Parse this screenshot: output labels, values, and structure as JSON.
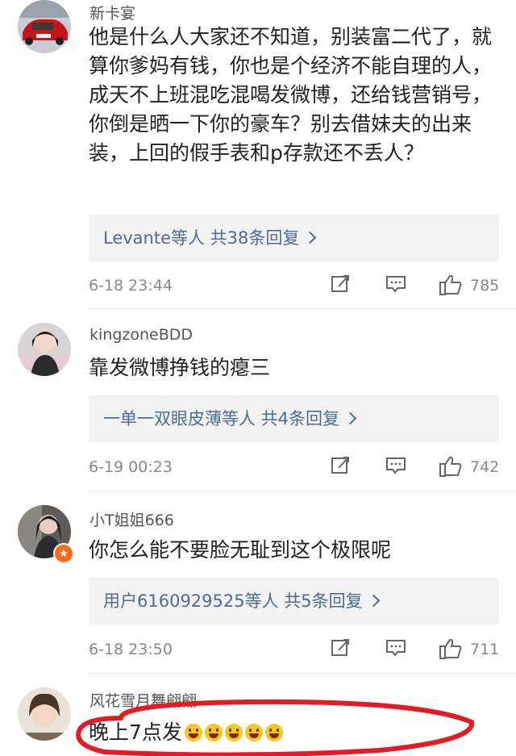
{
  "comments": [
    {
      "username": "新卡宴",
      "text": "他是什么人大家还不知道，别装富二代了，就算你爹妈有钱，你也是个经济不能自理的人，成天不上班混吃混喝发微博，还给钱营销号，你倒是晒一下你的豪车？别去借妹夫的出来装，上回的假手表和p存款还不丢人？",
      "reply_summary": "Levante等人  共38条回复",
      "timestamp": "6-18 23:44",
      "likes": "785"
    },
    {
      "username": "kingzoneBDD",
      "text": "靠发微博挣钱的瘪三",
      "reply_summary": "一单一双眼皮薄等人  共4条回复",
      "timestamp": "6-19 00:23",
      "likes": "742"
    },
    {
      "username": "小T姐姐666",
      "text": "你怎么能不要脸无耻到这个极限呢",
      "reply_summary": "用户6160929525等人  共5条回复",
      "timestamp": "6-18 23:50",
      "likes": "711"
    },
    {
      "username": "风花雪月舞翩翩",
      "text": "晚上7点发"
    }
  ],
  "icons": {
    "repost": "repost-icon",
    "comment": "comment-icon",
    "like": "thumbs-up-icon",
    "chevron": "chevron-right-icon",
    "vip": "vip-badge-icon",
    "emoji": "grinning-emoji"
  },
  "colors": {
    "link": "#4d6c93",
    "meta": "#888888",
    "annotation": "#e31b23"
  }
}
